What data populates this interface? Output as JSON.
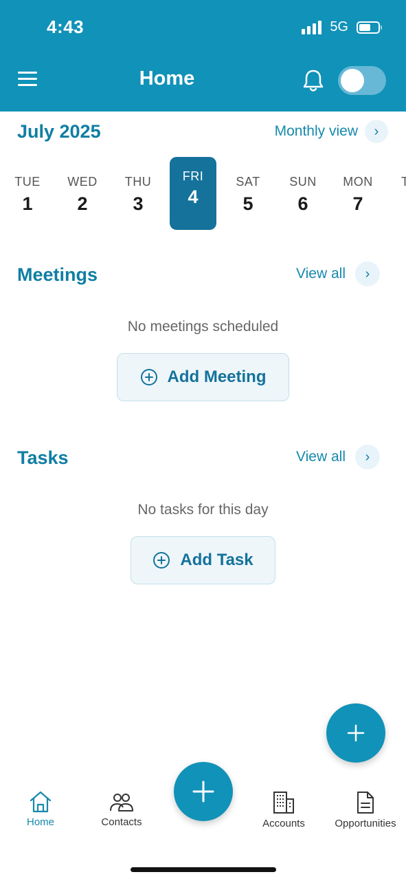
{
  "status_bar": {
    "time": "4:43",
    "network": "5G"
  },
  "header": {
    "title": "Home"
  },
  "calendar": {
    "month_label": "July 2025",
    "monthly_view_label": "Monthly view",
    "days": [
      {
        "name": "TUE",
        "num": "1"
      },
      {
        "name": "WED",
        "num": "2"
      },
      {
        "name": "THU",
        "num": "3"
      },
      {
        "name": "FRI",
        "num": "4"
      },
      {
        "name": "SAT",
        "num": "5"
      },
      {
        "name": "SUN",
        "num": "6"
      },
      {
        "name": "MON",
        "num": "7"
      },
      {
        "name": "T",
        "num": ""
      }
    ],
    "selected_day": "4"
  },
  "meetings": {
    "title": "Meetings",
    "view_all_label": "View all",
    "empty_text": "No meetings scheduled",
    "add_label": "Add Meeting"
  },
  "tasks": {
    "title": "Tasks",
    "view_all_label": "View all",
    "empty_text": "No tasks for this day",
    "add_label": "Add Task"
  },
  "bottom_nav": {
    "items": [
      {
        "label": "Home",
        "icon": "home-icon",
        "active": true
      },
      {
        "label": "Contacts",
        "icon": "contacts-icon",
        "active": false
      },
      {
        "label": "Accounts",
        "icon": "building-icon",
        "active": false
      },
      {
        "label": "Opportunities",
        "icon": "document-icon",
        "active": false
      }
    ]
  },
  "colors": {
    "primary": "#1192b8",
    "selected_day": "#14729b",
    "accent_text": "#0f7ea3"
  }
}
